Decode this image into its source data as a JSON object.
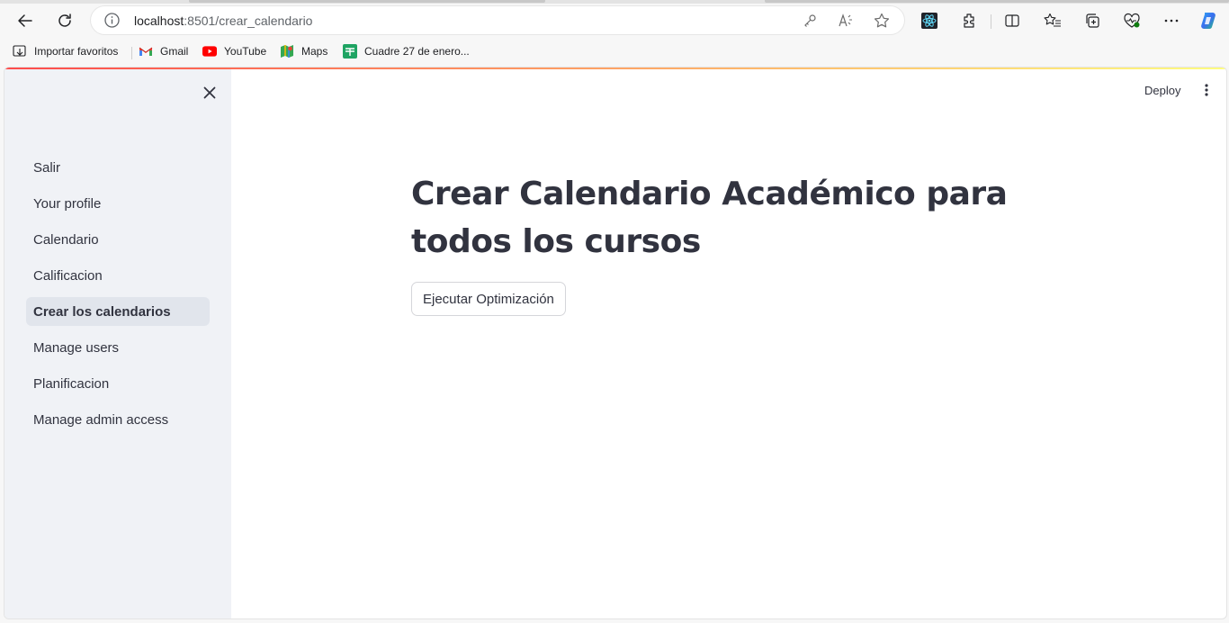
{
  "browser": {
    "url_host": "localhost",
    "url_path": ":8501/crear_calendario"
  },
  "bookmarks": [
    {
      "label": "Importar favoritos",
      "icon": "import-favorites-icon"
    },
    {
      "label": "Gmail",
      "icon": "gmail-icon"
    },
    {
      "label": "YouTube",
      "icon": "youtube-icon"
    },
    {
      "label": "Maps",
      "icon": "maps-icon"
    },
    {
      "label": "Cuadre 27 de enero...",
      "icon": "sheets-icon"
    }
  ],
  "app": {
    "deploy_label": "Deploy",
    "sidebar": {
      "items": [
        {
          "label": "Salir"
        },
        {
          "label": "Your profile"
        },
        {
          "label": "Calendario"
        },
        {
          "label": "Calificacion"
        },
        {
          "label": "Crear los calendarios",
          "active": true
        },
        {
          "label": "Manage users"
        },
        {
          "label": "Planificacion"
        },
        {
          "label": "Manage admin access"
        }
      ]
    },
    "main": {
      "title": "Crear Calendario Académico para todos los cursos",
      "button_label": "Ejecutar Optimización"
    }
  },
  "colors": {
    "sidebar_bg": "#f0f2f6",
    "active_item_bg": "#e1e5ec",
    "text": "#31333f",
    "decoration_start": "#ff4b4b",
    "decoration_end": "#fffd80"
  }
}
